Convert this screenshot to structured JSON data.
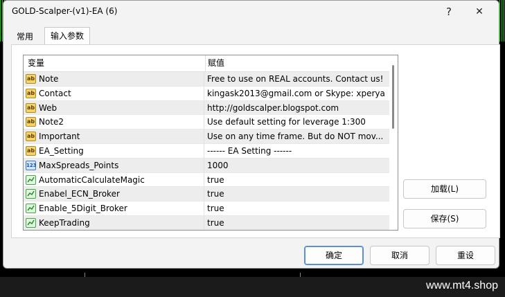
{
  "window": {
    "title": "GOLD-Scalper-(v1)-EA (6)",
    "help_glyph": "?",
    "close_glyph": "✕"
  },
  "tabs": [
    {
      "label": "常用"
    },
    {
      "label": "输入参数"
    }
  ],
  "table": {
    "headers": {
      "variable": "变量",
      "value": "赋值"
    },
    "rows": [
      {
        "type": "ab",
        "name": "Note",
        "value": "Free to use on REAL accounts. Contact us!"
      },
      {
        "type": "ab",
        "name": "Contact",
        "value": "kingask2013@gmail.com or Skype: xperya"
      },
      {
        "type": "ab",
        "name": "Web",
        "value": "http://goldscalper.blogspot.com"
      },
      {
        "type": "ab",
        "name": "Note2",
        "value": "Use default setting for leverage 1:300"
      },
      {
        "type": "ab",
        "name": "Important",
        "value": "Use on any time frame. But do NOT mov..."
      },
      {
        "type": "ab",
        "name": "EA_Setting",
        "value": "------ EA Setting ------"
      },
      {
        "type": "123",
        "name": "MaxSpreads_Points",
        "value": "1000"
      },
      {
        "type": "bool",
        "name": "AutomaticCalculateMagic",
        "value": "true"
      },
      {
        "type": "bool",
        "name": "Enabel_ECN_Broker",
        "value": "true"
      },
      {
        "type": "bool",
        "name": "Enable_5Digit_Broker",
        "value": "true"
      },
      {
        "type": "bool",
        "name": "KeepTrading",
        "value": "true"
      }
    ]
  },
  "icon_texts": {
    "ab": "ab",
    "num": "123"
  },
  "side_buttons": {
    "load": "加载(L)",
    "save": "保存(S)"
  },
  "footer_buttons": {
    "ok": "确定",
    "cancel": "取消",
    "reset": "重设"
  },
  "watermark": "www.mt4.shop",
  "colors": {
    "ok_border": "#5a8fd3",
    "row_alt": "#ededed"
  }
}
